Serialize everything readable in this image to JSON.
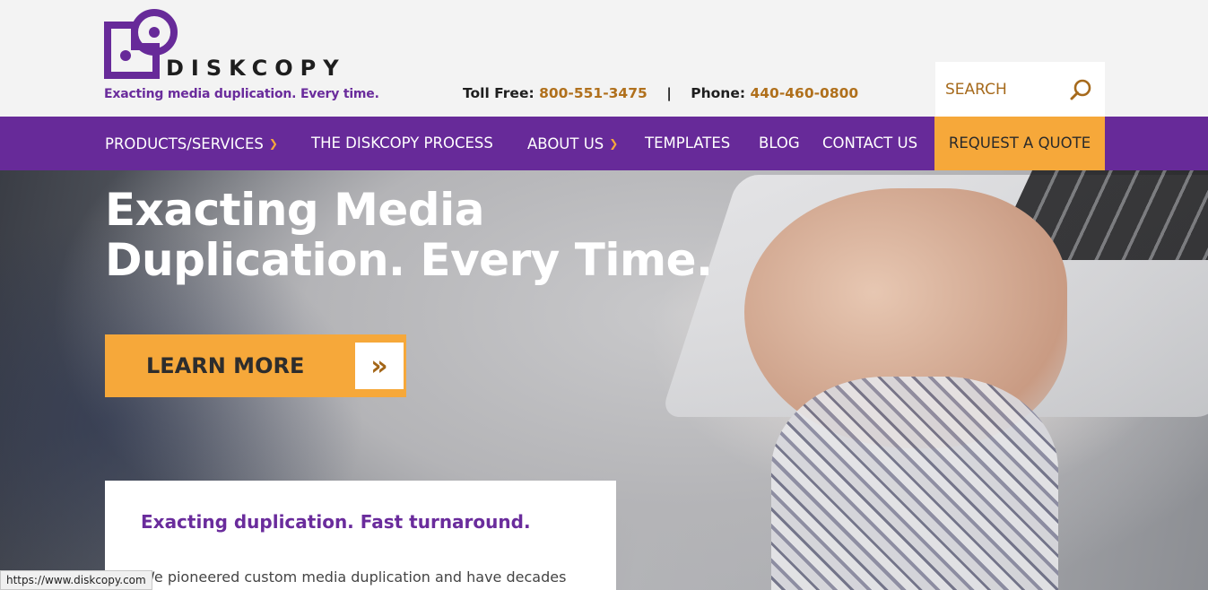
{
  "header": {
    "brand_name": "DISKCOPY",
    "tagline": "Exacting media duplication. Every time.",
    "toll_free_label": "Toll Free:",
    "toll_free_number": "800-551-3475",
    "separator": "|",
    "phone_label": "Phone:",
    "phone_number": "440-460-0800",
    "search_placeholder": "SEARCH",
    "colors": {
      "purple": "#672a99",
      "orange": "#f6a83a",
      "gold_text": "#b0701c"
    }
  },
  "nav": {
    "items": [
      {
        "label": "PRODUCTS/SERVICES",
        "has_dropdown": true,
        "icon": "chevron-down-icon"
      },
      {
        "label": "THE DISKCOPY PROCESS",
        "has_dropdown": false
      },
      {
        "label": "ABOUT US",
        "has_dropdown": true,
        "icon": "chevron-down-icon"
      },
      {
        "label": "TEMPLATES",
        "has_dropdown": false
      },
      {
        "label": "BLOG",
        "has_dropdown": false
      },
      {
        "label": "CONTACT US",
        "has_dropdown": false
      }
    ],
    "cta_label": "REQUEST A QUOTE"
  },
  "hero": {
    "title_line1": "Exacting Media",
    "title_line2": "Duplication. Every Time.",
    "button_label": "LEARN MORE",
    "button_icon": "double-chevron-right-icon"
  },
  "card": {
    "title": "Exacting duplication. Fast turnaround.",
    "text": "We pioneered custom media duplication and have decades"
  },
  "status_bar": {
    "url": "https://www.diskcopy.com"
  }
}
